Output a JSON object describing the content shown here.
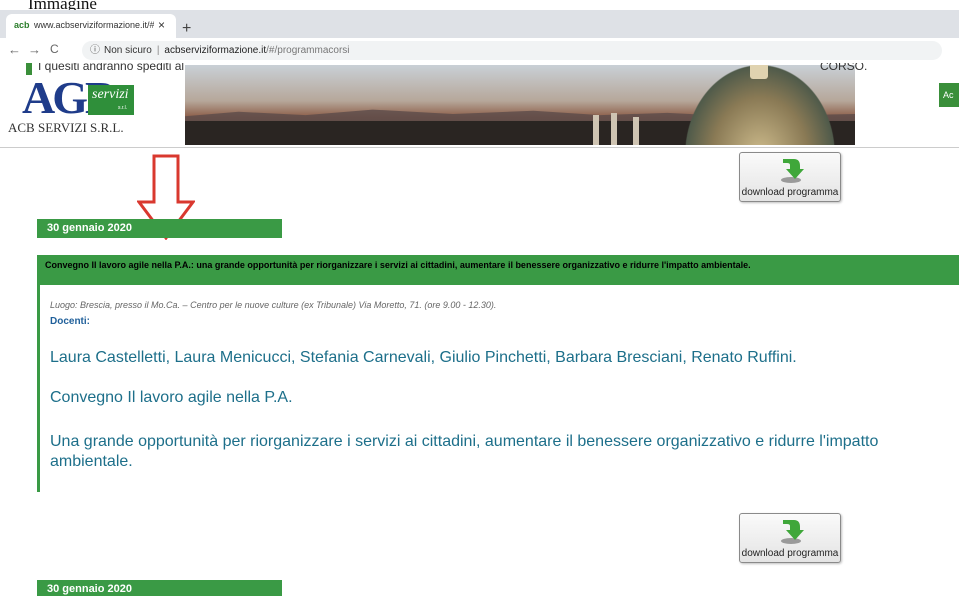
{
  "top_fragment": "Immagine",
  "browser": {
    "tab_favicon": "acb",
    "tab_title": "www.acbserviziformazione.it/#/p",
    "tab_close": "×",
    "new_tab": "+",
    "back": "←",
    "forward": "→",
    "reload": "C",
    "security_label": "Non sicuro",
    "separator": "|",
    "url_host": "acbserviziformazione.it",
    "url_path": "/#/programmacorsi"
  },
  "header": {
    "notice_left": "I quesiti andranno spediti al",
    "notice_right": "CORSO.",
    "logo_letters": "AGB",
    "logo_word": "servizi",
    "logo_small": "s.r.l.",
    "company_name": "ACB SERVIZI S.R.L.",
    "side_button": "Ac"
  },
  "download": {
    "label": "download programma"
  },
  "courses": [
    {
      "date": "30 gennaio 2020",
      "title": "Convegno Il lavoro agile nella P.A.: una grande opportunità per riorganizzare i servizi ai cittadini, aumentare il benessere organizzativo e ridurre l'impatto ambientale.",
      "luogo": "Luogo: Brescia, presso il Mo.Ca. – Centro per le nuove culture (ex Tribunale) Via Moretto, 71. (ore 9.00 - 12.30).",
      "docenti_label": "Docenti:",
      "docenti": "Laura Castelletti, Laura Menicucci, Stefania Carnevali, Giulio Pinchetti, Barbara Bresciani, Renato Ruffini.",
      "heading": "Convegno Il lavoro agile nella P.A.",
      "description": "Una grande opportunità per riorganizzare i servizi ai cittadini, aumentare il benessere organizzativo e ridurre l'impatto ambientale."
    },
    {
      "date": "30 gennaio 2020"
    }
  ],
  "colors": {
    "brand_green": "#3a9a45",
    "text_blue": "#1d6f8a",
    "arrow_red": "#d9382f"
  },
  "icons": [
    "down-arrow-annotation-icon",
    "download-icon",
    "info-icon",
    "close-icon"
  ]
}
